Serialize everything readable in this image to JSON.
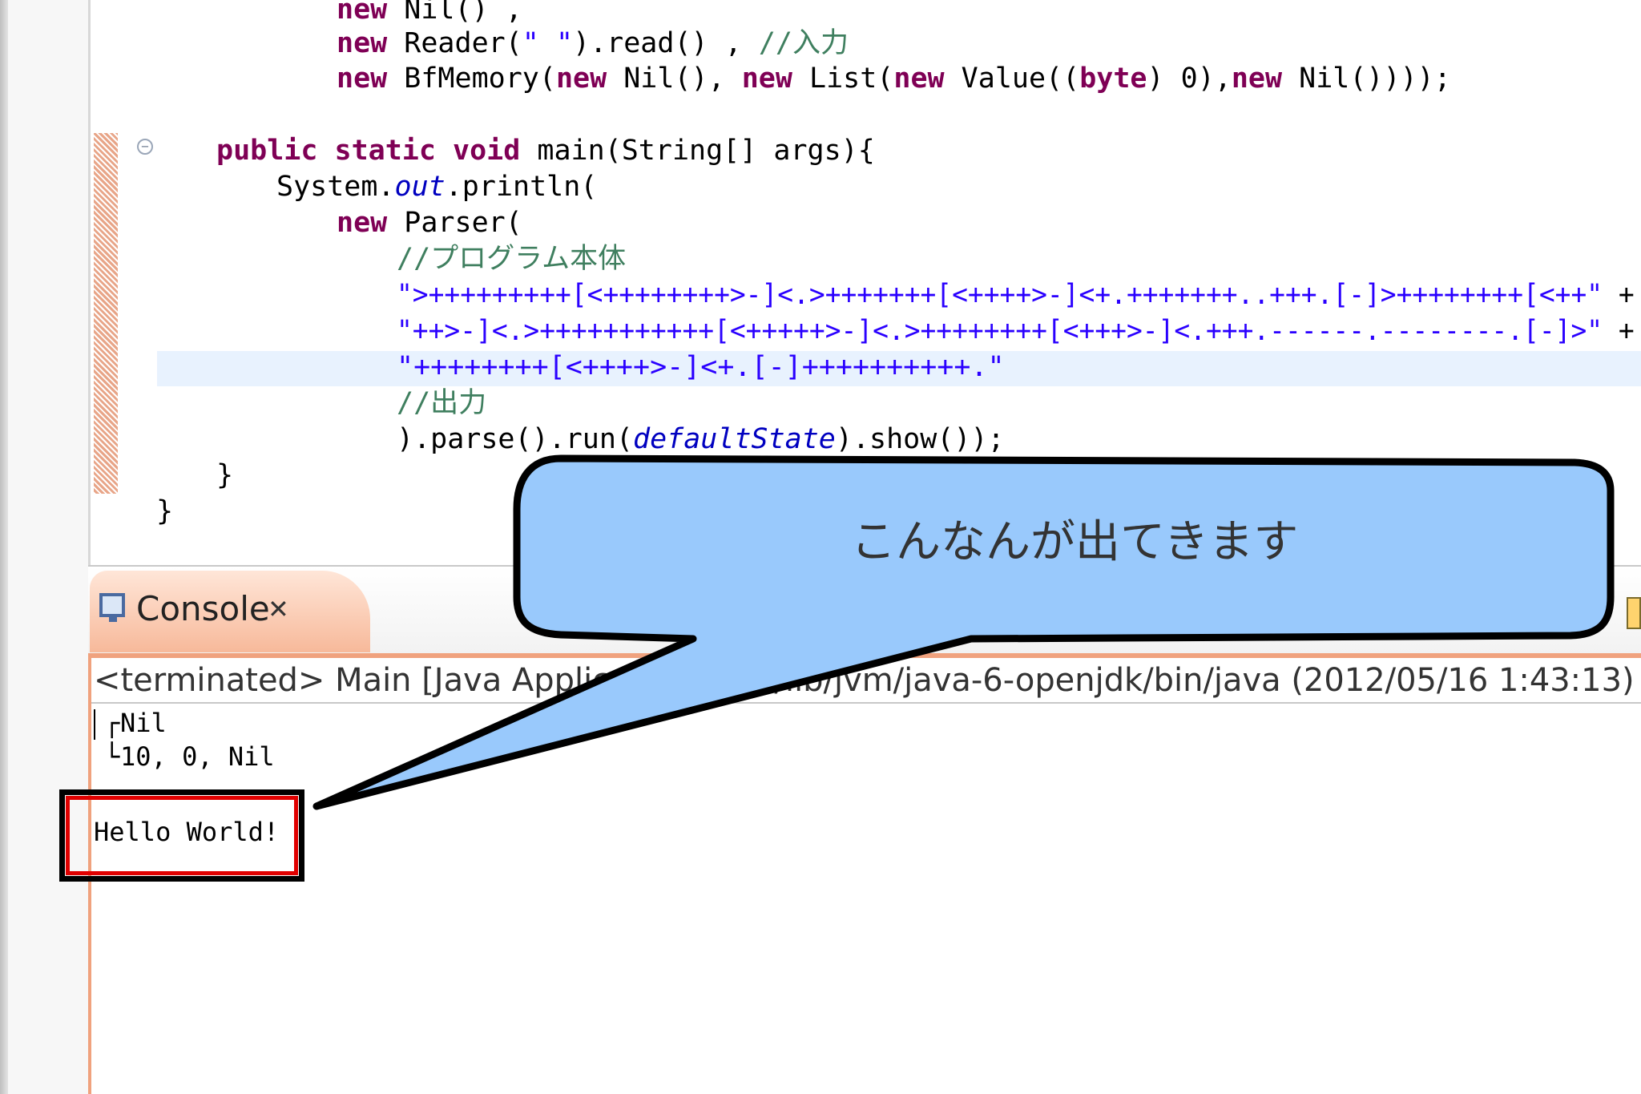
{
  "editor": {
    "lines": [
      [
        {
          "t": "new",
          "c": "kw"
        },
        {
          "t": " Nil() ,"
        }
      ],
      [
        {
          "t": "new",
          "c": "kw"
        },
        {
          "t": " Reader("
        },
        {
          "t": "\" \"",
          "c": "str"
        },
        {
          "t": ").read() , "
        },
        {
          "t": "//入力",
          "c": "cmt"
        }
      ],
      [
        {
          "t": "new",
          "c": "kw"
        },
        {
          "t": " BfMemory("
        },
        {
          "t": "new",
          "c": "kw"
        },
        {
          "t": " Nil(), "
        },
        {
          "t": "new",
          "c": "kw"
        },
        {
          "t": " List("
        },
        {
          "t": "new",
          "c": "kw"
        },
        {
          "t": " Value(("
        },
        {
          "t": "byte",
          "c": "kw"
        },
        {
          "t": ") 0),"
        },
        {
          "t": "new",
          "c": "kw"
        },
        {
          "t": " Nil())));"
        }
      ],
      [
        {
          "t": "public static void",
          "c": "kw"
        },
        {
          "t": " main(String[] args){"
        }
      ],
      [
        {
          "t": "System."
        },
        {
          "t": "out",
          "c": "fld"
        },
        {
          "t": ".println("
        }
      ],
      [
        {
          "t": "new",
          "c": "kw"
        },
        {
          "t": " Parser("
        }
      ],
      [
        {
          "t": "//プログラム本体",
          "c": "cmt"
        }
      ],
      [
        {
          "t": "\">+++++++++[<++++++++>-]<.>+++++++[<++++>-]<+.+++++++..+++.[-]>++++++++[<++\"",
          "c": "str"
        },
        {
          "t": " +"
        }
      ],
      [
        {
          "t": "\"++>-]<.>+++++++++++[<+++++>-]<.>++++++++[<+++>-]<.+++.------.--------.[-]>\"",
          "c": "str"
        },
        {
          "t": " +"
        }
      ],
      [
        {
          "t": "\"++++++++[<++++>-]<+.[-]++++++++++.\"",
          "c": "str"
        }
      ],
      [
        {
          "t": "//出力",
          "c": "cmt"
        }
      ],
      [
        {
          "t": ").parse().run("
        },
        {
          "t": "defaultState",
          "c": "fld"
        },
        {
          "t": ").show());"
        }
      ],
      [
        {
          "t": "}"
        }
      ],
      [
        {
          "t": "}"
        }
      ]
    ]
  },
  "console": {
    "tab_label": "Console",
    "tab_close": "✕",
    "status": "<terminated> Main [Java Application] /usr/lib/jvm/java-6-openjdk/bin/java (2012/05/16 1:43:13)",
    "output": {
      "line1": "Nil",
      "line2": "10, 0, Nil",
      "hello": "Hello World!"
    }
  },
  "callout": {
    "text": "こんなんが出てきます",
    "fill": "#99c9fc",
    "stroke": "#000000"
  },
  "colors": {
    "keyword": "#7f0055",
    "string": "#2a00ff",
    "comment": "#3f7f5f",
    "field": "#0000c0",
    "tab_accent": "#f0a27e",
    "highlight_box": "#e00000"
  }
}
